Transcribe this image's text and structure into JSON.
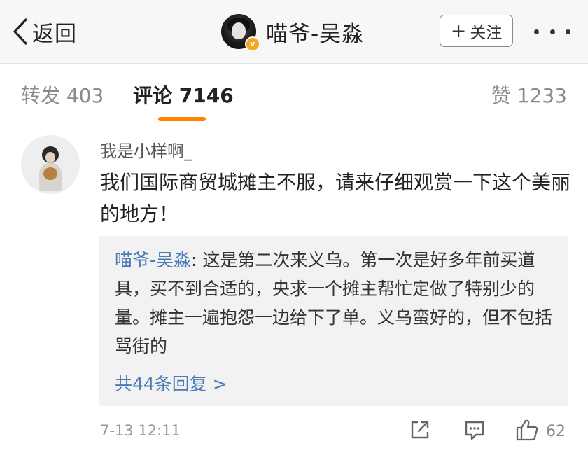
{
  "nav": {
    "back_label": "返回",
    "title": "喵爷-吴淼",
    "verified_badge": "v",
    "follow_plus": "+",
    "follow_label": "关注",
    "more_icon": "more-dots-icon",
    "accent_color": "#f5a623"
  },
  "tabs": {
    "repost": "转发 403",
    "comment": "评论 7146",
    "like": "赞 1233",
    "active": "comment",
    "indicator_color": "#ff8200"
  },
  "comment": {
    "user": "我是小样啊_",
    "text": "我们国际商贸城摊主不服，请来仔细观赏一下这个美丽的地方！",
    "reply": {
      "author": "喵爷-吴淼",
      "separator": ": ",
      "text": "这是第二次来义乌。第一次是好多年前买道具，买不到合适的，央求一个摊主帮忙定做了特别少的量。摊主一遍抱怨一边给下了单。义乌蛮好的，但不包括骂街的",
      "more_label": "共44条回复 >",
      "link_color": "#4a79b8"
    },
    "time": "7-13 12:11",
    "like_count": "62",
    "icons": [
      "share-icon",
      "comment-icon",
      "like-icon"
    ]
  }
}
